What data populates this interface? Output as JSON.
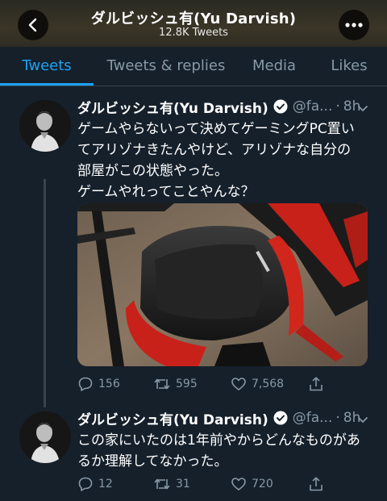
{
  "header": {
    "title": "ダルビッシュ有(Yu Darvish)",
    "subtitle": "12.8K Tweets"
  },
  "tabs": [
    {
      "label": "Tweets",
      "active": true
    },
    {
      "label": "Tweets & replies",
      "active": false
    },
    {
      "label": "Media",
      "active": false
    },
    {
      "label": "Likes",
      "active": false
    }
  ],
  "tweets": [
    {
      "name": "ダルビッシュ有(Yu Darvish)",
      "handle": "@fa...",
      "separator": "·",
      "time": "8h",
      "text_lines": [
        "ゲームやらないって決めてゲーミングPC置い",
        "てアリゾナきたんやけど、アリゾナな自分の",
        "部屋がこの状態やった。",
        "ゲームやれってことやんな？"
      ],
      "replies": "156",
      "retweets": "595",
      "likes": "7,568",
      "has_media": true
    },
    {
      "name": "ダルビッシュ有(Yu Darvish)",
      "handle": "@fa...",
      "separator": "·",
      "time": "8h",
      "text_lines": [
        "この家にいたのは1年前やからどんなものがあ",
        "るか理解してなかった。"
      ],
      "replies": "12",
      "retweets": "31",
      "likes": "720",
      "has_media": false
    }
  ],
  "colors": {
    "background": "#15202b",
    "accent": "#1da1f2",
    "muted": "#8899a6",
    "divider": "#38444d"
  },
  "icons": [
    "chevron-left-icon",
    "more-icon",
    "verified-icon",
    "chevron-down-icon",
    "reply-icon",
    "retweet-icon",
    "like-icon",
    "share-icon"
  ]
}
